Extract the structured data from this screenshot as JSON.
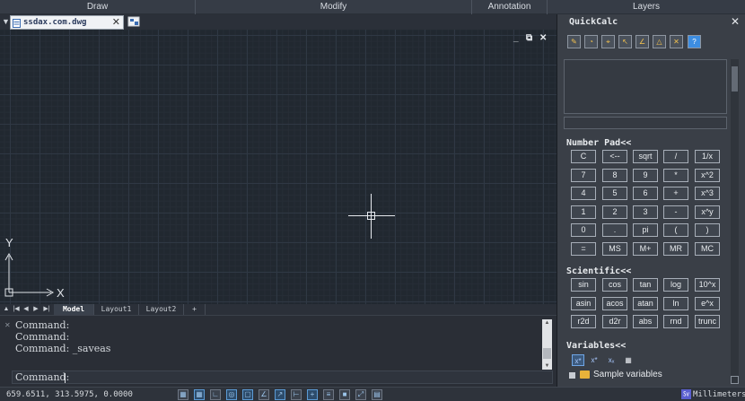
{
  "ribbon": {
    "panels": [
      "Draw",
      "Modify",
      "Annotation",
      "Layers"
    ]
  },
  "file_tabs": {
    "menu_icon": "triangle-down-icon",
    "active_file": "ssdax.com.dwg",
    "close_glyph": "✕",
    "new_tab_icon": "new-drawing-icon"
  },
  "viewport": {
    "controls": [
      "_",
      "⧉",
      "✕"
    ],
    "ucs": {
      "x_label": "X",
      "y_label": "Y"
    }
  },
  "layout_tabs": {
    "nav": [
      "▲",
      "|◀",
      "◀",
      "▶",
      "▶|"
    ],
    "tabs": [
      "Model",
      "Layout1",
      "Layout2",
      "+"
    ],
    "active": "Model"
  },
  "command_line": {
    "side_glyph": "✕",
    "history": [
      "Command:",
      "Command:",
      "Command: _saveas"
    ],
    "prompt": "Command:"
  },
  "status_bar": {
    "coordinates": "659.6511, 313.5975, 0.0000",
    "buttons": [
      "grid",
      "snap",
      "ortho",
      "polar",
      "osnap",
      "3dosnap",
      "otrack",
      "ducs",
      "dyn",
      "lwt",
      "tpy",
      "qp",
      "sc"
    ],
    "units": "Millimeters"
  },
  "quickcalc": {
    "title": "QuickCalc",
    "close_glyph": "✕",
    "toolbar": [
      "clear-icon",
      "history-icon",
      "get-coordinates-icon",
      "distance-icon",
      "angle-icon",
      "intersection-icon",
      "help-icon",
      "info-icon"
    ],
    "number_pad_title": "Number Pad<<",
    "number_pad": [
      [
        "C",
        "<--",
        "sqrt",
        "/",
        "1/x"
      ],
      [
        "7",
        "8",
        "9",
        "*",
        "x^2"
      ],
      [
        "4",
        "5",
        "6",
        "+",
        "x^3"
      ],
      [
        "1",
        "2",
        "3",
        "-",
        "x^y"
      ],
      [
        "0",
        ".",
        "pi",
        "(",
        ")"
      ],
      [
        "=",
        "MS",
        "M+",
        "MR",
        "MC"
      ]
    ],
    "scientific_title": "Scientific<<",
    "scientific": [
      [
        "sin",
        "cos",
        "tan",
        "log",
        "10^x"
      ],
      [
        "asin",
        "acos",
        "atan",
        "ln",
        "e^x"
      ],
      [
        "r2d",
        "d2r",
        "abs",
        "rnd",
        "trunc"
      ]
    ],
    "variables_title": "Variables<<",
    "variables_tools": [
      "new-variable-icon",
      "edit-variable-icon",
      "delete-variable-icon",
      "calculator-icon"
    ],
    "tree_item": "Sample variables"
  }
}
